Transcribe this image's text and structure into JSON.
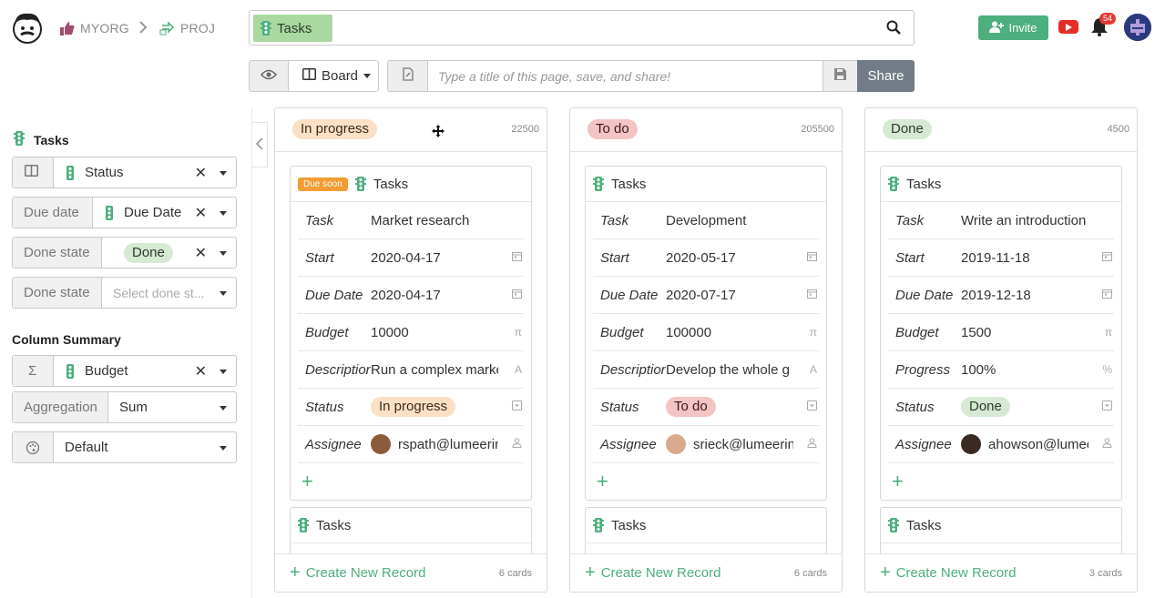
{
  "topbar": {
    "org": "MYORG",
    "project": "PROJ",
    "search_chip": "Tasks",
    "invite": "Invite",
    "notifications": "54"
  },
  "viewbar": {
    "view_mode": "Board",
    "title_placeholder": "Type a title of this page, save, and share!",
    "share": "Share"
  },
  "panel": {
    "table": "Tasks",
    "group_field": "Status",
    "due_date_label": "Due date",
    "due_date_field": "Due Date",
    "done_state_label": "Done state",
    "done_state_value": "Done",
    "done_state_placeholder": "Select done st...",
    "summary_title": "Column Summary",
    "summary_field": "Budget",
    "aggregation_label": "Aggregation",
    "aggregation_value": "Sum",
    "style_value": "Default"
  },
  "columns": [
    {
      "name": "In progress",
      "sum": "22500",
      "count": "6 cards",
      "create": "Create New Record",
      "card": {
        "badge": "Due soon",
        "table": "Tasks",
        "fields": [
          {
            "name": "Task",
            "value": "Market research",
            "type": ""
          },
          {
            "name": "Start",
            "value": "2020-04-17",
            "type": "calendar"
          },
          {
            "name": "Due Date",
            "value": "2020-04-17",
            "type": "calendar"
          },
          {
            "name": "Budget",
            "value": "10000",
            "type": "π"
          },
          {
            "name": "Description",
            "value": "Run a complex market",
            "type": "A"
          },
          {
            "name": "Status",
            "value": "In progress",
            "type": "select"
          },
          {
            "name": "Assignee",
            "value": "rspath@lumeering",
            "type": "user"
          }
        ]
      },
      "card2_table": "Tasks"
    },
    {
      "name": "To do",
      "sum": "205500",
      "count": "6 cards",
      "create": "Create New Record",
      "card": {
        "badge": "",
        "table": "Tasks",
        "fields": [
          {
            "name": "Task",
            "value": "Development",
            "type": ""
          },
          {
            "name": "Start",
            "value": "2020-05-17",
            "type": "calendar"
          },
          {
            "name": "Due Date",
            "value": "2020-07-17",
            "type": "calendar"
          },
          {
            "name": "Budget",
            "value": "100000",
            "type": "π"
          },
          {
            "name": "Description",
            "value": "Develop the whole g",
            "type": "A"
          },
          {
            "name": "Status",
            "value": "To do",
            "type": "select"
          },
          {
            "name": "Assignee",
            "value": "srieck@lumeering",
            "type": "user"
          }
        ]
      },
      "card2_table": "Tasks"
    },
    {
      "name": "Done",
      "sum": "4500",
      "count": "3 cards",
      "create": "Create New Record",
      "card": {
        "badge": "",
        "table": "Tasks",
        "fields": [
          {
            "name": "Task",
            "value": "Write an introduction",
            "type": ""
          },
          {
            "name": "Start",
            "value": "2019-11-18",
            "type": "calendar"
          },
          {
            "name": "Due Date",
            "value": "2019-12-18",
            "type": "calendar"
          },
          {
            "name": "Budget",
            "value": "1500",
            "type": "π"
          },
          {
            "name": "Progress",
            "value": "100%",
            "type": "%"
          },
          {
            "name": "Status",
            "value": "Done",
            "type": "select"
          },
          {
            "name": "Assignee",
            "value": "ahowson@lumeering",
            "type": "user"
          }
        ]
      },
      "card2_table": "Tasks"
    }
  ],
  "colors": {
    "accent_green": "#4caf7d",
    "chip_green": "#a9d9a0",
    "in_progress": "#fbe0c6",
    "to_do": "#f2c4c4",
    "done": "#d6ead3",
    "due_soon": "#f39c34",
    "share": "#717c86"
  }
}
